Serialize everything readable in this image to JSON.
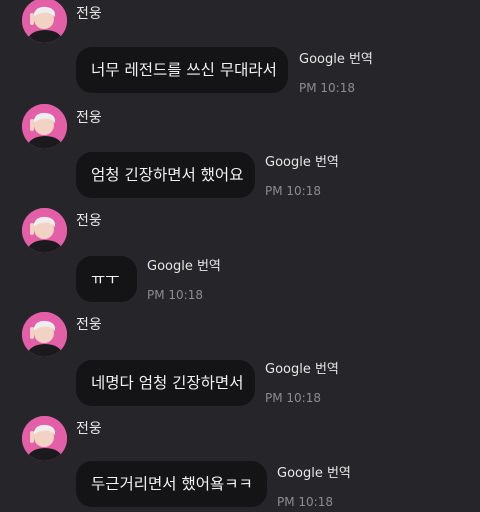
{
  "messages": [
    {
      "sender": "전웅",
      "text": "너무 레전드를 쓰신 무대라서",
      "translate_label": "Google 번역",
      "time": "PM 10:18"
    },
    {
      "sender": "전웅",
      "text": "엄청 긴장하면서 했어요",
      "translate_label": "Google 번역",
      "time": "PM 10:18"
    },
    {
      "sender": "전웅",
      "text": "ㅠㅜ",
      "translate_label": "Google 번역",
      "time": "PM 10:18"
    },
    {
      "sender": "전웅",
      "text": "네명다 엄청 긴장하면서",
      "translate_label": "Google 번역",
      "time": "PM 10:18"
    },
    {
      "sender": "전웅",
      "text": "두근거리면서 했어욬ㅋㅋ",
      "translate_label": "Google 번역",
      "time": "PM 10:18"
    }
  ],
  "colors": {
    "background": "#26262a",
    "bubble": "#141416",
    "avatar_bg": "#e35fa7"
  },
  "icons": {
    "avatar": "profile-photo"
  }
}
